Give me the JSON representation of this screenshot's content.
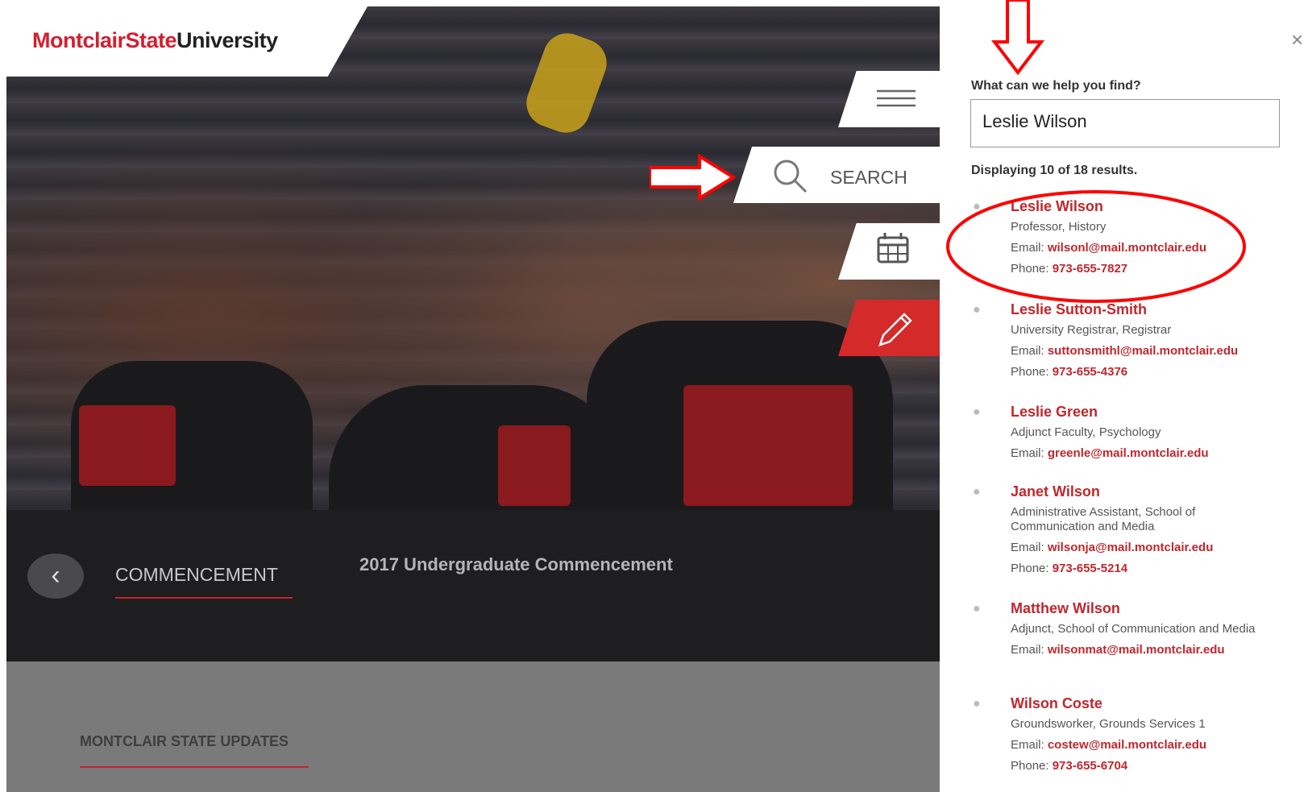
{
  "header": {
    "logo_part1": "Montclair",
    "logo_part2": "State",
    "logo_part3": "University"
  },
  "side_tabs": {
    "search_label": "SEARCH"
  },
  "hero_caption": {
    "category": "COMMENCEMENT",
    "title": "2017 Undergraduate Commencement"
  },
  "updates": {
    "heading": "MONTCLAIR STATE UPDATES"
  },
  "search_panel": {
    "prompt": "What can we help you find?",
    "query": "Leslie Wilson",
    "displaying": "Displaying 10 of 18 results.",
    "email_label": "Email: ",
    "phone_label": "Phone: ",
    "results": [
      {
        "name": "Leslie Wilson",
        "title": "Professor, History",
        "email": "wilsonl@mail.montclair.edu",
        "phone": "973-655-7827"
      },
      {
        "name": "Leslie Sutton-Smith",
        "title": "University Registrar, Registrar",
        "email": "suttonsmithl@mail.montclair.edu",
        "phone": "973-655-4376"
      },
      {
        "name": "Leslie Green",
        "title": "Adjunct Faculty, Psychology",
        "email": "greenle@mail.montclair.edu"
      },
      {
        "name": "Janet Wilson",
        "title": "Administrative Assistant, School of Communication and Media",
        "email": "wilsonja@mail.montclair.edu",
        "phone": "973-655-5214"
      },
      {
        "name": "Matthew Wilson",
        "title": "Adjunct, School of Communication and Media",
        "email": "wilsonmat@mail.montclair.edu"
      },
      {
        "name": "Wilson Coste",
        "title": "Groundsworker, Grounds Services 1",
        "email": "costew@mail.montclair.edu",
        "phone": "973-655-6704"
      }
    ]
  },
  "colors": {
    "brand_red": "#c0272d",
    "edit_tab_red": "#d42a2a",
    "annotation_red": "#ff0000"
  },
  "icons": {
    "menu": "hamburger-icon",
    "search": "search-icon",
    "calendar": "calendar-icon",
    "edit": "pencil-icon",
    "back": "chevron-left-icon",
    "close": "close-icon",
    "person": "person-icon"
  }
}
